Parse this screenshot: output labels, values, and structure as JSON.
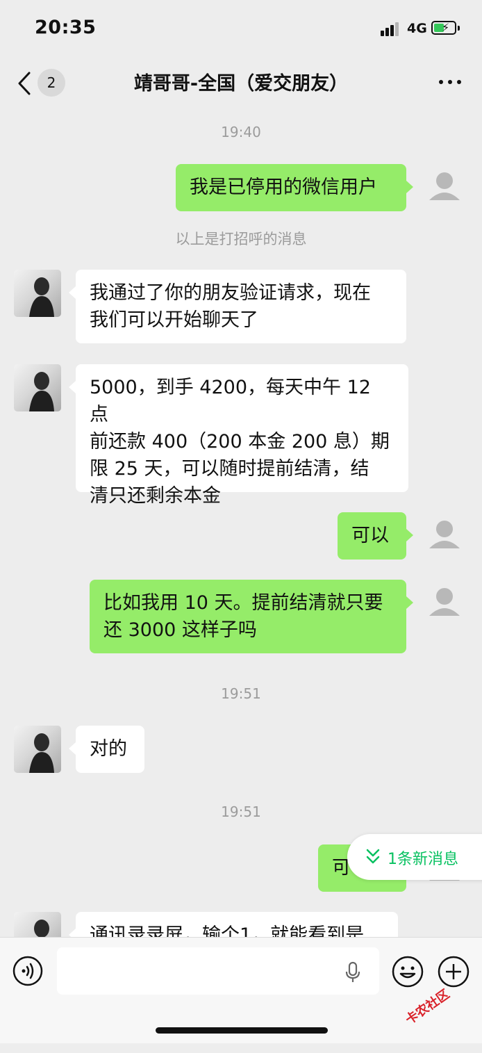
{
  "status_bar": {
    "time": "20:35",
    "network": "4G"
  },
  "nav": {
    "unread_count": "2",
    "title": "靖哥哥-全国（爱交朋友）"
  },
  "chat": {
    "time_1": "19:40",
    "msg_1": "我是已停用的微信用户",
    "system_note": "以上是打招呼的消息",
    "msg_2_line1": "我通过了你的朋友验证请求，现在",
    "msg_2_line2": "我们可以开始聊天了",
    "msg_3_line1": "5000，到手 4200，每天中午 12 点",
    "msg_3_line2": "前还款 400（200 本金 200 息）期",
    "msg_3_line3": "限 25 天，可以随时提前结清，结",
    "msg_3_line4": "清只还剩余本金",
    "msg_4": "可以",
    "msg_5_line1": "比如我用 10 天。提前结清就只要",
    "msg_5_line2": "还 3000 这样子吗",
    "time_2": "19:51",
    "msg_6": "对的",
    "time_3": "19:51",
    "msg_7_partial": "可",
    "msg_8_partial": "通讯录录屏，输个1，就能看到是"
  },
  "new_message_pill": {
    "label": "1条新消息"
  },
  "watermark": {
    "text": "卡农社区"
  },
  "colors": {
    "my_bubble": "#95ec69",
    "accent_green": "#07c160",
    "background": "#ededed"
  }
}
